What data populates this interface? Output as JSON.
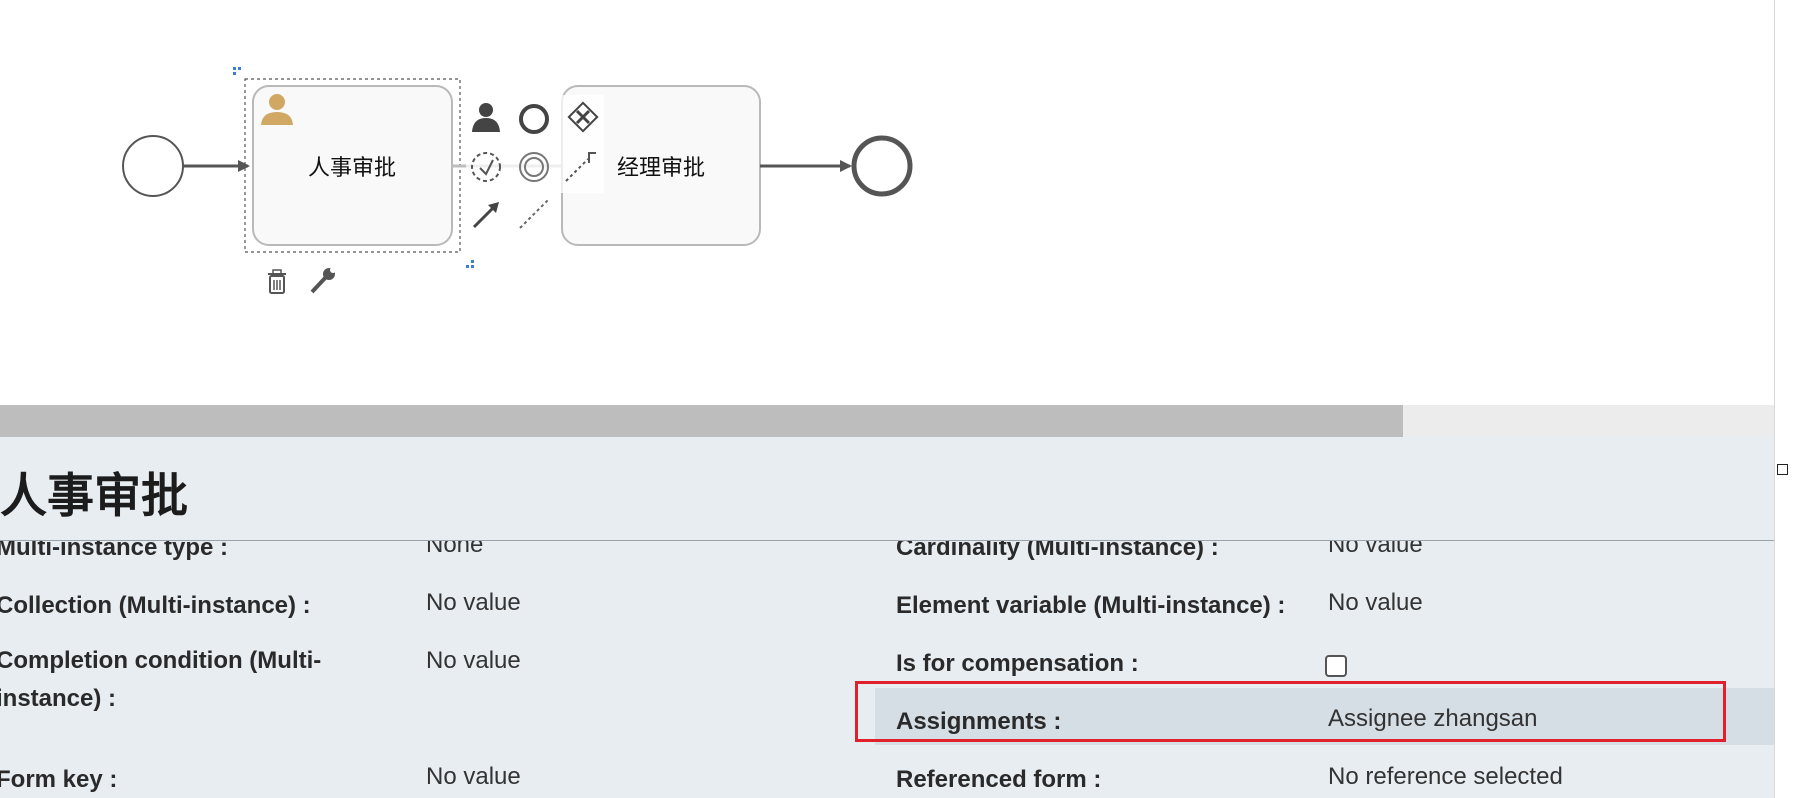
{
  "canvas": {
    "tasks": [
      {
        "id": "hr",
        "label": "人事审批"
      },
      {
        "id": "mgr",
        "label": "经理审批"
      }
    ],
    "colors": {
      "stroke": "#555555",
      "task_fill": "#f9f9f9",
      "task_border": "#b9b9b9",
      "user_icon": "#d1a863",
      "selection": "#555555",
      "handle": "#3b7dd8"
    },
    "context_pad": [
      "user-task-icon",
      "end-event-icon",
      "gateway-icon",
      "intermediate-event-icon",
      "boundary-event-icon",
      "annotation-icon",
      "sequence-flow-icon",
      "association-icon",
      "delete-icon",
      "wrench-icon"
    ]
  },
  "panel": {
    "title": "人事审批",
    "properties": {
      "multi_instance_type": {
        "label": "Multi-instance type :",
        "value": "None"
      },
      "cardinality": {
        "label": "Cardinality (Multi-instance) :",
        "value": "No value"
      },
      "collection": {
        "label": "Collection (Multi-instance) :",
        "value": "No value"
      },
      "element_variable": {
        "label": "Element variable (Multi-instance) :",
        "value": "No value"
      },
      "completion_condition": {
        "label": "Completion condition (Multi-instance) :",
        "value": "No value"
      },
      "is_for_compensation": {
        "label": "Is for compensation :",
        "checked": false
      },
      "assignments": {
        "label": "Assignments :",
        "value": "Assignee zhangsan"
      },
      "form_key": {
        "label": "Form key :",
        "value": "No value"
      },
      "referenced_form": {
        "label": "Referenced form :",
        "value": "No reference selected"
      }
    },
    "highlight_color": "#e0202a"
  }
}
